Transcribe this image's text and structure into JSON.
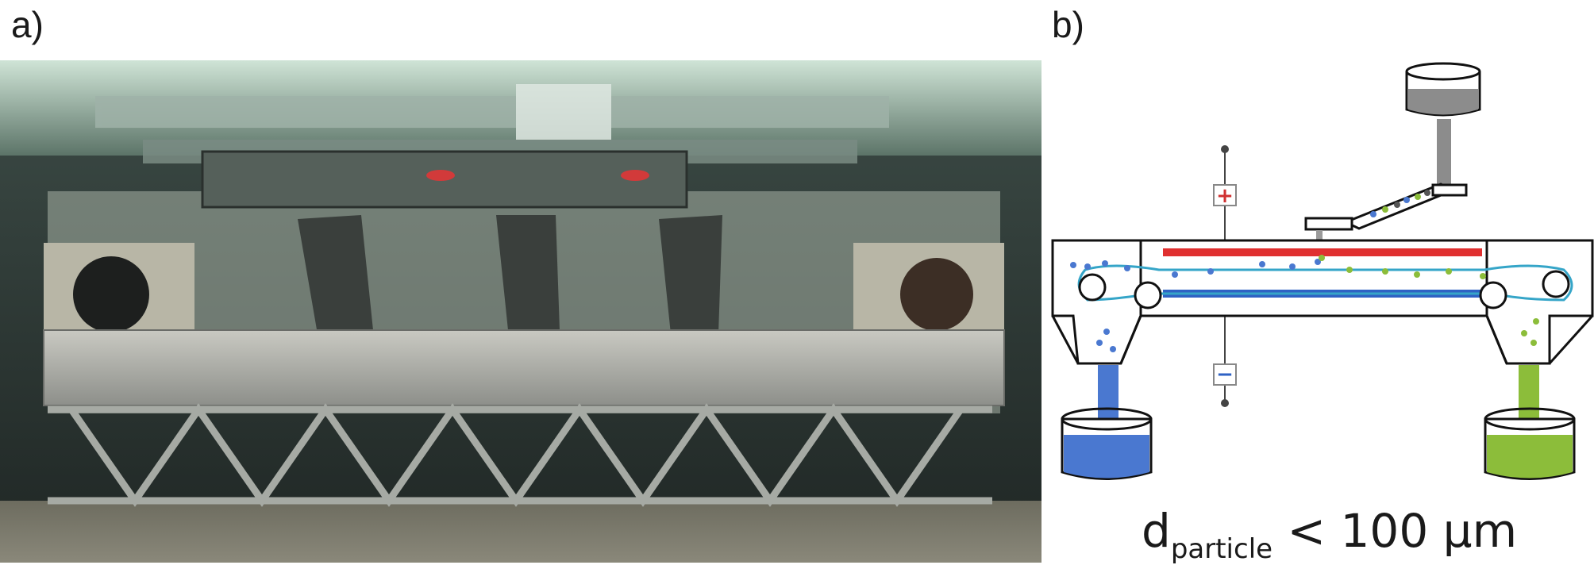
{
  "panels": {
    "a": {
      "label": "a)"
    },
    "b": {
      "label": "b)"
    }
  },
  "diagram": {
    "plus_symbol": "+",
    "minus_symbol": "−",
    "colors": {
      "positive_electrode": "#e03030",
      "negative_electrode": "#2e62c4",
      "belt": "#35a5c8",
      "blue_particles": "#4a78d0",
      "green_particles": "#8cbd3a",
      "feed_material": "#8a8a8a"
    }
  },
  "formula": {
    "symbol": "d",
    "subscript": "particle",
    "relation": "< 100 μm"
  }
}
